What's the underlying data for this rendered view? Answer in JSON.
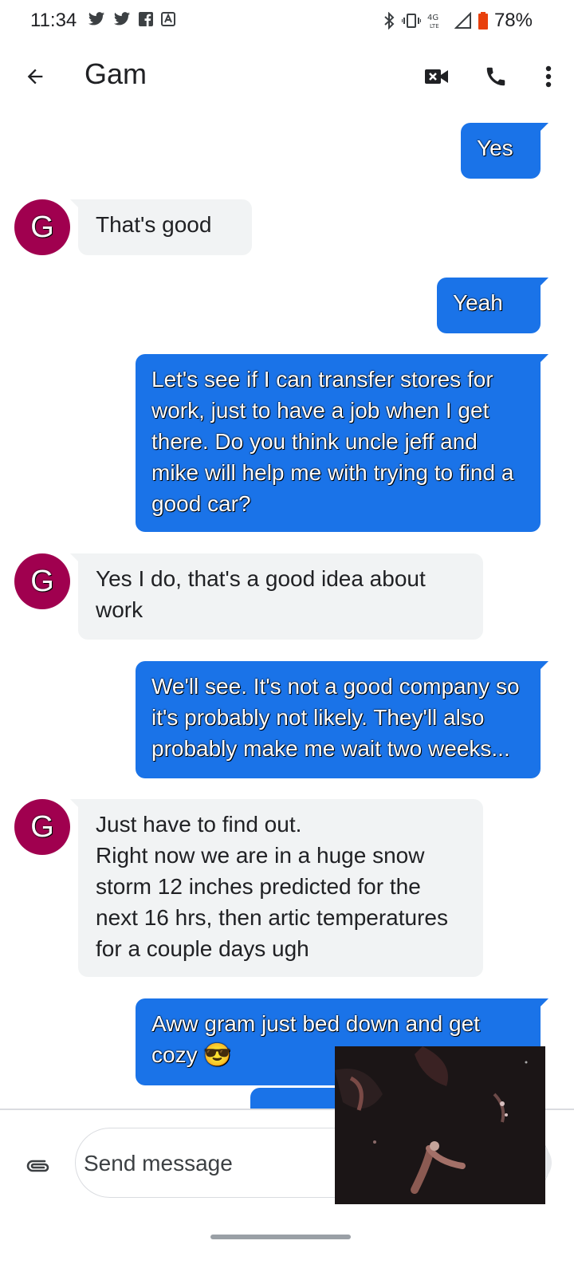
{
  "status_bar": {
    "time": "11:34",
    "battery_percent": "78%",
    "icons": [
      "twitter-icon",
      "twitter-icon",
      "facebook-icon",
      "app-icon",
      "bluetooth-icon",
      "vibrate-icon",
      "4g-lte-icon",
      "signal-icon",
      "battery-icon"
    ]
  },
  "header": {
    "contact_name": "Gam",
    "icons": [
      "back-arrow-icon",
      "video-call-icon",
      "phone-icon",
      "more-vert-icon"
    ]
  },
  "messages": [
    {
      "direction": "out",
      "text": "Yes"
    },
    {
      "direction": "in",
      "avatar": "G",
      "text": "That's good"
    },
    {
      "direction": "out",
      "text": "Yeah"
    },
    {
      "direction": "out",
      "text": "Let's see if I can transfer stores for work, just to have a job when I get there. Do you think uncle jeff and mike will help me with trying to find a good car?"
    },
    {
      "direction": "in",
      "avatar": "G",
      "text": "Yes I do, that's a good idea about work"
    },
    {
      "direction": "out",
      "text": "We'll see. It's not a good company so it's probably not likely. They'll also probably make me wait two weeks..."
    },
    {
      "direction": "in",
      "avatar": "G",
      "text": "Just have to find out.\nRight now we are in a huge snow storm 12 inches predicted for the next 16 hrs, then artic temperatures for a couple days ugh"
    },
    {
      "direction": "out",
      "text": "Aww gram just bed down and get cozy 😎"
    }
  ],
  "composer": {
    "placeholder": "Send message"
  },
  "colors": {
    "outgoing_bubble": "#1a73e8",
    "incoming_bubble": "#f1f3f4",
    "avatar": "#a0004f"
  }
}
